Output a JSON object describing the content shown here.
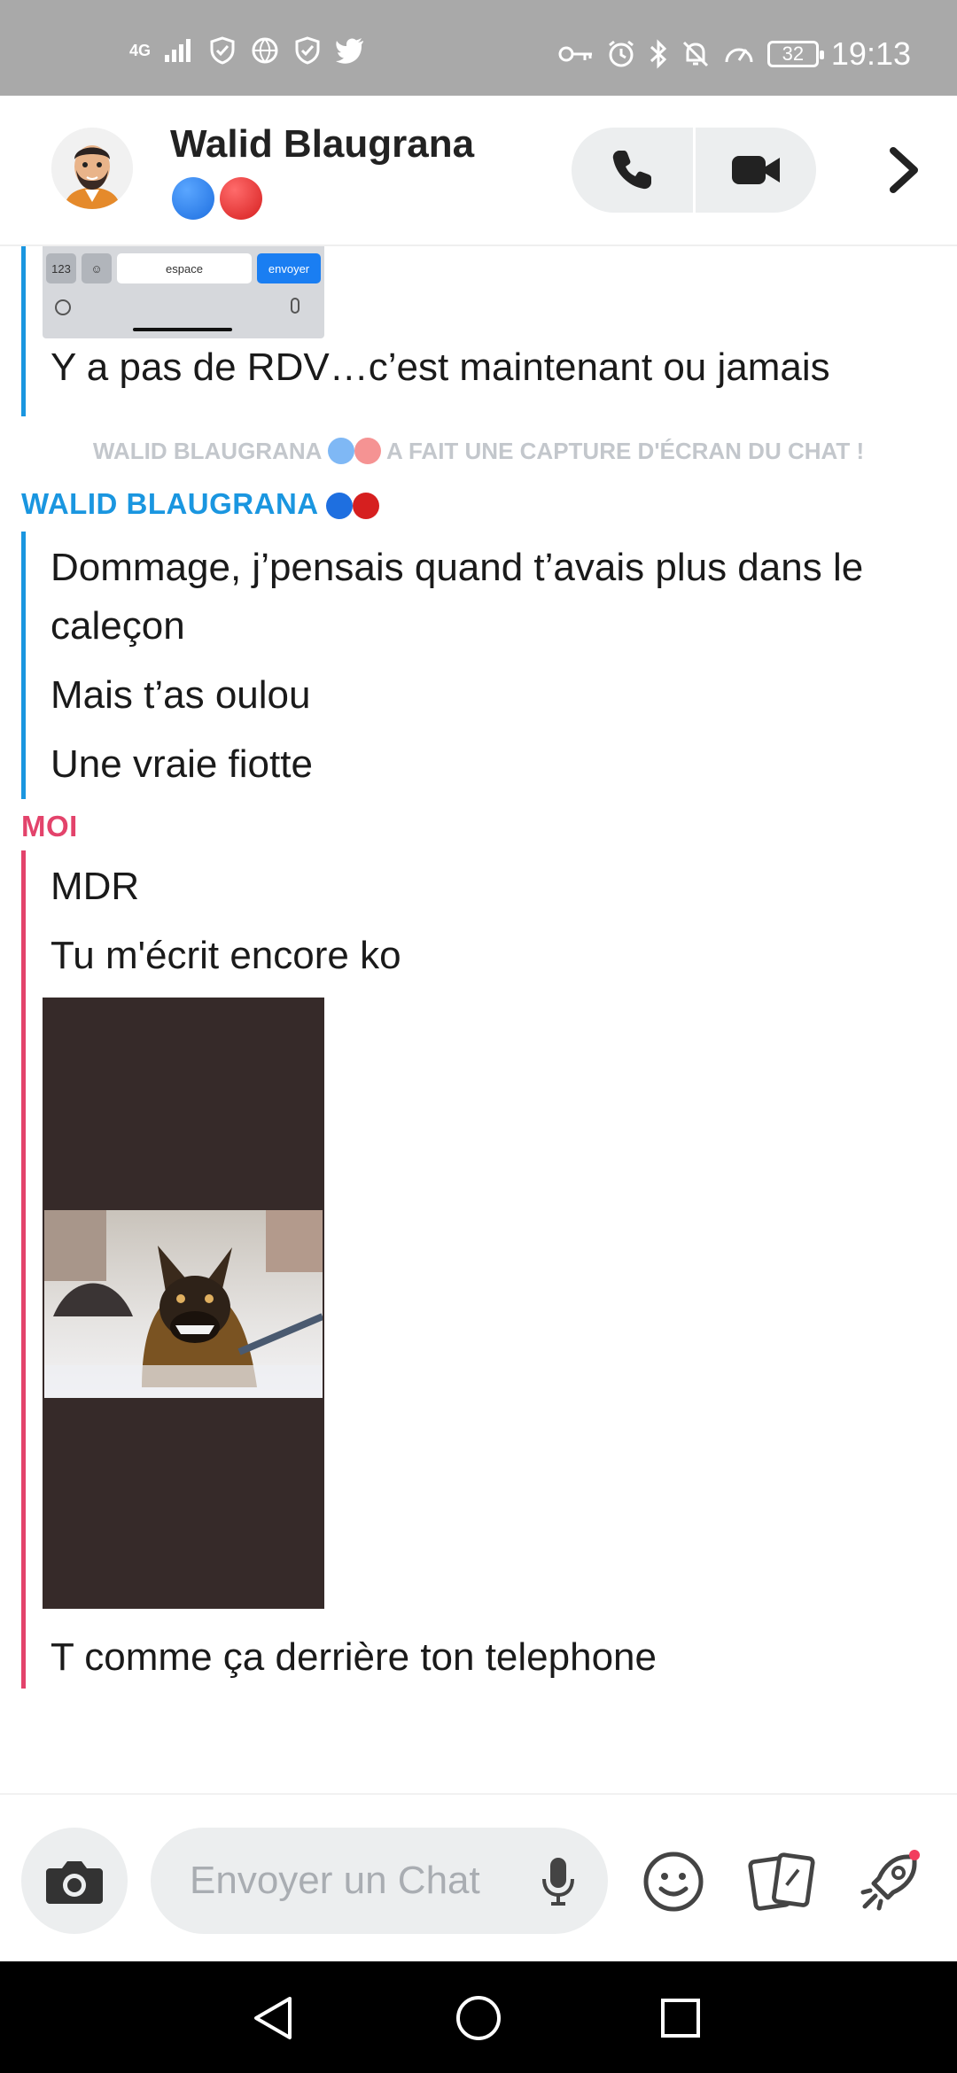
{
  "status_bar": {
    "network": "4G",
    "battery": "32",
    "time": "19:13"
  },
  "header": {
    "contact_name": "Walid Blaugrana",
    "contact_emojis": [
      "blue-circle",
      "red-circle"
    ]
  },
  "chat": {
    "keyboard_preview": {
      "key_123": "123",
      "space_label": "espace",
      "send_label": "envoyer"
    },
    "messages_top": [
      "Y a pas de RDV…c’est maintenant ou jamais"
    ],
    "system_note_prefix": "WALID BLAUGRANA",
    "system_note_suffix": "A FAIT UNE CAPTURE D'ÉCRAN DU CHAT !",
    "sender_friend": "WALID BLAUGRANA",
    "friend_messages": [
      "Dommage, j’pensais quand t’avais plus dans le caleçon",
      "Mais t’as oulou",
      "Une vraie fiotte"
    ],
    "sender_me": "MOI",
    "my_messages": [
      "MDR",
      "Tu m'écrit encore ko"
    ],
    "image_caption": "T comme ça derrière ton telephone"
  },
  "input": {
    "placeholder": "Envoyer un Chat"
  },
  "colors": {
    "friend_accent": "#1a96e0",
    "me_accent": "#e3436b"
  }
}
